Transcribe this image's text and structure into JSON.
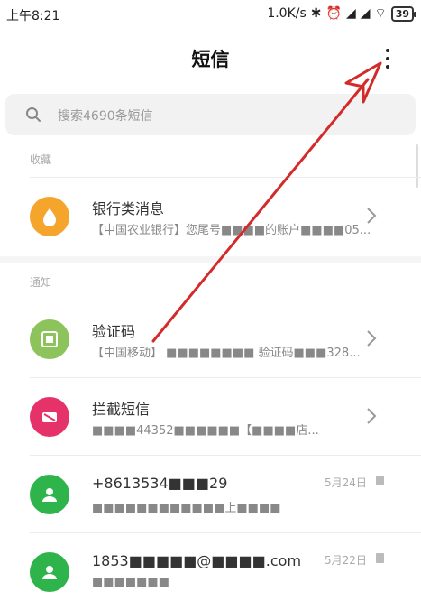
{
  "status_bar": {
    "time": "上午8:21",
    "speed": "1.0K/s",
    "bluetooth": "✱",
    "alarm": "⏰",
    "signal1": "◢",
    "signal2": "◢",
    "wifi": "⌔",
    "battery": "39"
  },
  "header": {
    "title": "短信",
    "more_icon": "more-vertical-icon"
  },
  "search": {
    "placeholder": "搜索4690条短信"
  },
  "sections": {
    "favorites": "收藏",
    "notifications": "通知"
  },
  "conversations": [
    {
      "name": "银行类消息",
      "preview": "【中国农业银行】您尾号■■■■的账户■■■■05...",
      "avatar_color": "#f5a42c",
      "trailing": "chevron"
    },
    {
      "name": "验证码",
      "preview": "【中国移动】 ■■■■■■■■ 验证码■■■328...",
      "avatar_color": "#8dc35b",
      "trailing": "chevron"
    },
    {
      "name": "拦截短信",
      "preview": "■■■■44352■■■■■■【■■■■店...",
      "avatar_color": "#e5336a",
      "trailing": "chevron"
    },
    {
      "name": "+8613534■■■29",
      "preview": "■■■■■■■■■■■■上■■■■",
      "avatar_color": "#2fb44b",
      "date": "5月24日"
    },
    {
      "name": "1853■■■■■@■■■■.com",
      "preview": "■■■■■■■",
      "avatar_color": "#2fb44b",
      "date": "5月22日"
    }
  ]
}
